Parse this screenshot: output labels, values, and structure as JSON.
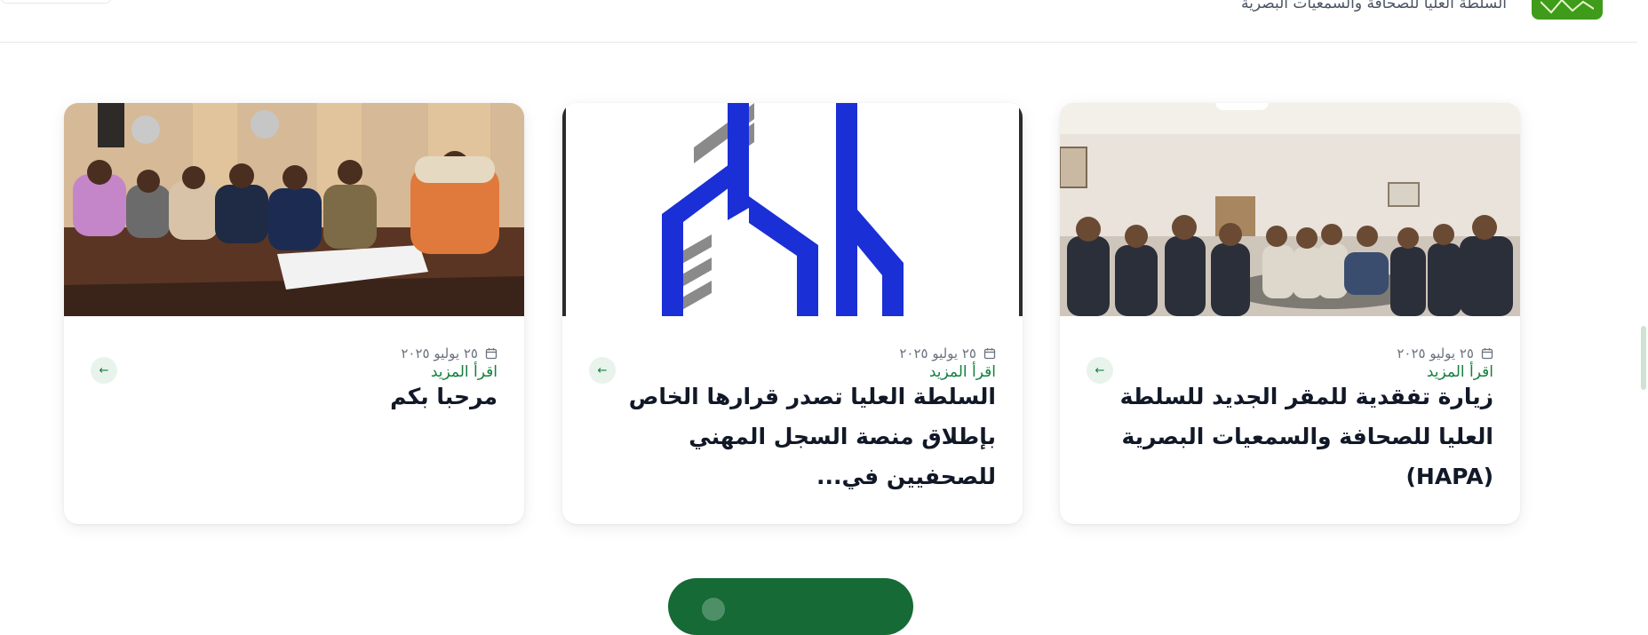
{
  "header": {
    "site_name": "السلطة العليا للصحافة والسمعيات البصرية"
  },
  "colors": {
    "brand_green": "#156a35",
    "logo_green": "#3f9b1a",
    "link_green": "#15803d",
    "arrow_bg": "#e8f3ec"
  },
  "cards": [
    {
      "date": "٢٥ يوليو ٢٠٢٥",
      "title": "زيارة تفقدية للمقر الجديد للسلطة العليا للصحافة والسمعيات البصرية (HAPA)",
      "read_more": "اقرأ المزيد",
      "arrow_icon": "arrow-left-icon",
      "image": "meeting-room-photo"
    },
    {
      "date": "٢٥ يوليو ٢٠٢٥",
      "title": "السلطة العليا تصدر قرارها الخاص بإطلاق منصة السجل المهني للصحفيين في...",
      "read_more": "اقرأ المزيد",
      "arrow_icon": "arrow-left-icon",
      "image": "platform-logo"
    },
    {
      "date": "٢٥ يوليو ٢٠٢٥",
      "title": "مرحبا بكم",
      "read_more": "اقرأ المزيد",
      "arrow_icon": "arrow-left-icon",
      "image": "conference-table-photo"
    }
  ]
}
